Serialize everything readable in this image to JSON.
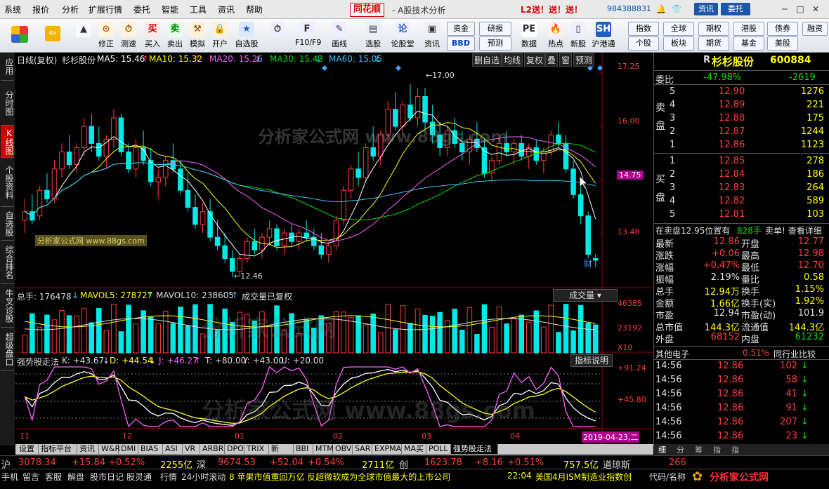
{
  "menu": [
    "系统",
    "报价",
    "分析",
    "扩展行情",
    "委托",
    "智能",
    "工具",
    "资讯",
    "帮助"
  ],
  "logo": "同花顺",
  "app_title": "- A股技术分析",
  "l2_text": "L2送！送！送！",
  "account_num": "984388831",
  "top_btns": [
    "资讯",
    "委托"
  ],
  "toolbar": [
    "修正",
    "测速",
    "买入",
    "卖出",
    "模拟",
    "开户",
    "自选股",
    "",
    "F10/F9",
    "画线",
    "选股",
    "论股堂",
    "资讯",
    "数据",
    "热点",
    "新股",
    "沪港通"
  ],
  "toolbar_grid": [
    [
      "资金",
      "研报"
    ],
    [
      "BBD",
      "预测"
    ]
  ],
  "toolbar_right": [
    [
      "指数",
      "全球",
      "期权",
      "港股",
      "债券"
    ],
    [
      "个股",
      "板块",
      "期货",
      "基金",
      "美股"
    ],
    [
      "融资"
    ]
  ],
  "left_tabs": [
    "应用",
    "分时图",
    "K线图",
    "个股资料",
    "自选股",
    "综合排名",
    "牛叉诊股",
    "超级盘口"
  ],
  "chart": {
    "head_left": "日线(复权)",
    "stock": "杉杉股份",
    "ma": [
      {
        "label": "MA5: 15.46",
        "arrow": "↑",
        "color": "#ffffff"
      },
      {
        "label": "MA10: 15.32",
        "arrow": "↑",
        "color": "#ffff00"
      },
      {
        "label": "MA20: 15.26",
        "arrow": "↓",
        "color": "#ff60ff"
      },
      {
        "label": "MA30: 15.43",
        "arrow": "↓",
        "color": "#00e000"
      },
      {
        "label": "MA60: 15.05",
        "arrow": "↓",
        "color": "#40c0ff"
      }
    ],
    "head_btns": [
      "删自选",
      "均线",
      "复权",
      "叠",
      "窗",
      "预测"
    ],
    "price_ticks": [
      "17.25",
      "16.00",
      "14.75",
      "13.48"
    ],
    "high_label": "17.00",
    "low_label": "12.46",
    "vol_head": "总手: 176478",
    "vol_ma5": "MAVOL5: 278727",
    "vol_ma10": "MAVOL10: 238605",
    "vol_note": "成交量已复权",
    "vol_btn": "成交量",
    "vol_ticks": [
      "46385",
      "23192",
      "X10"
    ],
    "ind_name": "强势股走法",
    "ind_K": "K: +43.67",
    "ind_D": "D: +44.54",
    "ind_J": "J: +46.27",
    "ind_T": "T: +80.00",
    "ind_Y": "Y: +43.00",
    "ind_U": "U: +20.00",
    "ind_btn": "指标说明",
    "ind_ticks": [
      "+91.24",
      "+45.80"
    ],
    "months": [
      "11",
      "12",
      "01",
      "02",
      "03",
      "04"
    ],
    "date_label": "2019-04-23,二",
    "cai": "财"
  },
  "quote": {
    "title": "杉杉股份",
    "code": "600884",
    "tag": "R",
    "weibi_label": "委比",
    "weibi": "-47.98%",
    "weicha": "-2619",
    "sell_label": "卖盘",
    "buy_label": "买盘",
    "sell": [
      [
        "5",
        "12.90",
        "1276"
      ],
      [
        "4",
        "12.89",
        "221"
      ],
      [
        "3",
        "12.88",
        "175"
      ],
      [
        "2",
        "12.87",
        "1244"
      ],
      [
        "1",
        "12.86",
        "1123"
      ]
    ],
    "buy": [
      [
        "1",
        "12.85",
        "278"
      ],
      [
        "2",
        "12.84",
        "186"
      ],
      [
        "3",
        "12.83",
        "264"
      ],
      [
        "4",
        "12.82",
        "589"
      ],
      [
        "5",
        "12.81",
        "103"
      ]
    ],
    "ad_line": "在卖盘12.95位置有",
    "ad_amount": "828手",
    "ad_tail": "卖单! 查看详细",
    "stats": [
      [
        "最新",
        "12.86",
        "开盘",
        "12.77"
      ],
      [
        "涨跌",
        "+0.06",
        "最高",
        "12.98"
      ],
      [
        "涨幅",
        "+0.47%",
        "最低",
        "12.70"
      ],
      [
        "振幅",
        "2.19%",
        "量比",
        "0.58"
      ],
      [
        "总手",
        "12.94万",
        "换手",
        "1.15%"
      ],
      [
        "金额",
        "1.66亿",
        "换手(实)",
        "1.92%"
      ],
      [
        "市盈",
        "12.94",
        "市盈(动)",
        "101.9"
      ],
      [
        "总市值",
        "144.3亿",
        "流通值",
        "144.3亿"
      ],
      [
        "外盘",
        "68152",
        "内盘",
        "61232"
      ]
    ],
    "industry": "其他电子",
    "industry_pct": "0.51%",
    "industry_btn": "同行业比较",
    "ticks": [
      [
        "14:56",
        "12.86",
        "102",
        "↓"
      ],
      [
        "14:56",
        "12.86",
        "58",
        "↓"
      ],
      [
        "14:56",
        "12.86",
        "41",
        "↓"
      ],
      [
        "14:56",
        "12.86",
        "91",
        "↓"
      ],
      [
        "14:56",
        "12.86",
        "207",
        "↓"
      ],
      [
        "14:56",
        "12.86",
        "23",
        "↓"
      ]
    ],
    "bottom_tabs": [
      "细",
      "分",
      "筹",
      "指",
      "指"
    ]
  },
  "indicator_tabs": [
    "设置",
    "指标平台",
    "资讯",
    "W&R",
    "DMI",
    "BIAS",
    "ASI",
    "VR",
    "ARBR",
    "DPO",
    "TRIX",
    "新DMA",
    "BBI",
    "MTM",
    "OBV",
    "SAR",
    "EXPMA",
    "MA买卖",
    "POLL",
    "强势股走法"
  ],
  "ticker": {
    "sh_label": "沪",
    "sh": "3078.34",
    "sh_chg": "+15.84",
    "sh_pct": "+0.52%",
    "sh_amt": "2255亿",
    "sz_label": "深",
    "sz": "9674.53",
    "sz_chg": "+52.04",
    "sz_pct": "+0.54%",
    "sz_amt": "2711亿",
    "cy_label": "创",
    "cy": "1623.78",
    "cy_chg": "+8.16",
    "cy_pct": "+0.51%",
    "cy_amt": "757.5亿",
    "dj_label": "道琼斯",
    "dj": "266"
  },
  "status": {
    "items": [
      "手机",
      "留言",
      "客服",
      "解盘",
      "股市日记",
      "股灵通",
      "行情",
      "24小时滚动"
    ],
    "news1": "8 苹果市值重回万亿 反超微软成为全球市值最大的上市公司",
    "news2_time": "22:04",
    "news2": "美国4月ISM制造业指数创",
    "right": "代码/名称"
  },
  "watermark": "分析家公式网",
  "watermark_url": "www.88gs.com",
  "colors": {
    "up": "#ff3c3c",
    "down": "#00e8e8",
    "ma5": "#ffffff",
    "ma10": "#ffff00",
    "ma20": "#ff60ff",
    "ma30": "#00e000",
    "ma60": "#40c0ff"
  },
  "chart_data": {
    "type": "candlestick",
    "ohlc": [
      [
        13.8,
        14.3,
        13.5,
        14.0
      ],
      [
        14.0,
        14.4,
        13.7,
        13.8
      ],
      [
        13.9,
        14.6,
        13.8,
        14.5
      ],
      [
        14.5,
        14.9,
        14.2,
        14.3
      ],
      [
        14.3,
        15.2,
        14.2,
        15.0
      ],
      [
        15.0,
        15.6,
        14.8,
        15.4
      ],
      [
        15.4,
        15.8,
        15.0,
        15.1
      ],
      [
        15.1,
        15.6,
        14.9,
        15.5
      ],
      [
        15.5,
        16.2,
        15.3,
        16.0
      ],
      [
        16.0,
        16.3,
        15.4,
        15.6
      ],
      [
        15.6,
        16.0,
        15.2,
        15.3
      ],
      [
        15.3,
        15.8,
        15.0,
        15.7
      ],
      [
        15.7,
        16.4,
        15.5,
        16.2
      ],
      [
        16.2,
        16.3,
        15.3,
        15.4
      ],
      [
        15.4,
        15.6,
        14.9,
        15.0
      ],
      [
        15.0,
        15.7,
        14.8,
        15.5
      ],
      [
        15.5,
        15.9,
        15.1,
        15.2
      ],
      [
        15.2,
        15.5,
        14.6,
        14.7
      ],
      [
        14.7,
        15.0,
        14.3,
        14.8
      ],
      [
        14.8,
        15.3,
        14.6,
        15.2
      ],
      [
        15.2,
        15.6,
        14.9,
        15.0
      ],
      [
        15.0,
        15.2,
        14.4,
        14.5
      ],
      [
        14.5,
        14.9,
        14.0,
        14.1
      ],
      [
        14.1,
        14.4,
        13.6,
        13.7
      ],
      [
        13.7,
        14.2,
        13.5,
        14.0
      ],
      [
        14.0,
        14.3,
        13.3,
        13.4
      ],
      [
        13.4,
        13.8,
        13.1,
        13.2
      ],
      [
        13.2,
        13.5,
        12.8,
        12.9
      ],
      [
        12.9,
        13.1,
        12.46,
        12.6
      ],
      [
        12.6,
        13.0,
        12.5,
        12.9
      ],
      [
        12.9,
        13.4,
        12.8,
        13.3
      ],
      [
        13.3,
        13.6,
        13.0,
        13.1
      ],
      [
        13.1,
        13.5,
        12.9,
        13.4
      ],
      [
        13.4,
        13.8,
        13.2,
        13.6
      ],
      [
        13.6,
        13.7,
        13.1,
        13.2
      ],
      [
        13.2,
        13.6,
        13.0,
        13.5
      ],
      [
        13.5,
        13.7,
        13.2,
        13.3
      ],
      [
        13.3,
        13.6,
        13.1,
        13.5
      ],
      [
        13.5,
        13.8,
        13.3,
        13.4
      ],
      [
        13.4,
        13.6,
        13.1,
        13.2
      ],
      [
        13.2,
        13.5,
        12.9,
        13.0
      ],
      [
        13.0,
        13.3,
        12.8,
        13.2
      ],
      [
        13.2,
        13.9,
        13.1,
        13.8
      ],
      [
        13.8,
        14.6,
        13.7,
        14.5
      ],
      [
        14.5,
        15.1,
        14.3,
        15.0
      ],
      [
        15.0,
        15.4,
        14.6,
        14.8
      ],
      [
        14.8,
        15.6,
        14.7,
        15.5
      ],
      [
        15.5,
        16.0,
        15.2,
        15.3
      ],
      [
        15.3,
        15.9,
        15.1,
        15.8
      ],
      [
        15.8,
        16.6,
        15.6,
        16.4
      ],
      [
        16.4,
        16.8,
        15.9,
        16.0
      ],
      [
        16.0,
        16.6,
        15.8,
        16.5
      ],
      [
        16.5,
        17.0,
        16.1,
        16.2
      ],
      [
        16.2,
        16.9,
        16.0,
        16.7
      ],
      [
        16.7,
        16.9,
        15.9,
        16.1
      ],
      [
        16.1,
        16.5,
        15.6,
        15.8
      ],
      [
        15.8,
        16.1,
        15.3,
        15.5
      ],
      [
        15.5,
        16.0,
        15.3,
        15.9
      ],
      [
        15.9,
        16.2,
        15.5,
        15.6
      ],
      [
        15.6,
        15.9,
        15.2,
        15.4
      ],
      [
        15.4,
        15.8,
        15.1,
        15.7
      ],
      [
        15.7,
        16.1,
        15.4,
        15.5
      ],
      [
        15.5,
        15.7,
        14.8,
        14.9
      ],
      [
        14.9,
        15.3,
        14.7,
        15.2
      ],
      [
        15.2,
        15.8,
        15.1,
        15.6
      ],
      [
        15.6,
        15.9,
        15.3,
        15.4
      ],
      [
        15.4,
        15.7,
        15.1,
        15.6
      ],
      [
        15.6,
        15.8,
        15.2,
        15.3
      ],
      [
        15.3,
        15.6,
        15.0,
        15.5
      ],
      [
        15.5,
        15.7,
        15.1,
        15.2
      ],
      [
        15.2,
        15.5,
        14.9,
        15.4
      ],
      [
        15.4,
        15.9,
        15.3,
        15.8
      ],
      [
        15.8,
        16.1,
        15.5,
        15.6
      ],
      [
        15.6,
        15.8,
        14.9,
        15.0
      ],
      [
        15.0,
        15.2,
        14.3,
        14.4
      ],
      [
        14.4,
        14.6,
        13.7,
        13.9
      ],
      [
        13.9,
        14.0,
        12.9,
        13.0
      ],
      [
        12.9,
        13.0,
        12.7,
        12.86
      ]
    ],
    "volume_scale": "X10",
    "x": [
      "11",
      "12",
      "01",
      "02",
      "03",
      "04"
    ],
    "ylim": [
      12.3,
      17.4
    ]
  }
}
